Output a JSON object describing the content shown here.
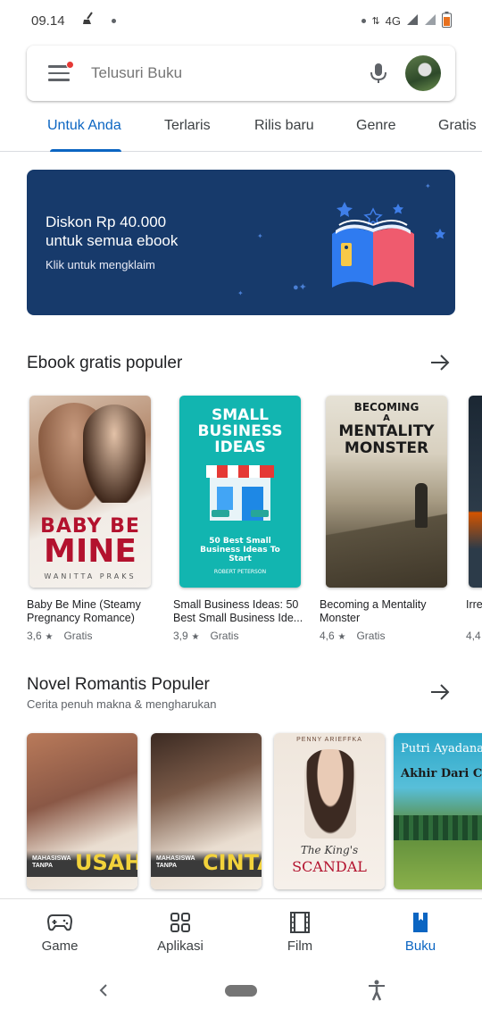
{
  "status_bar": {
    "time": "09.14",
    "network": "4G"
  },
  "search": {
    "placeholder": "Telusuri Buku"
  },
  "tabs": [
    {
      "label": "Untuk Anda",
      "active": true
    },
    {
      "label": "Terlaris"
    },
    {
      "label": "Rilis baru"
    },
    {
      "label": "Genre"
    },
    {
      "label": "Gratis"
    }
  ],
  "banner": {
    "title_line1": "Diskon Rp 40.000",
    "title_line2": "untuk semua ebook",
    "subtitle": "Klik untuk mengklaim"
  },
  "section1": {
    "title": "Ebook gratis populer",
    "books": [
      {
        "title": "Baby Be Mine (Steamy Pregnancy Romance)",
        "rating": "3,6",
        "price": "Gratis",
        "cover_line1": "BABY BE",
        "cover_line2": "MINE",
        "cover_author": "WANITTA PRAKS"
      },
      {
        "title": "Small Business Ideas: 50 Best Small Business Ide...",
        "rating": "3,9",
        "price": "Gratis",
        "cover_line1": "SMALL",
        "cover_line2": "BUSINESS",
        "cover_line3": "IDEAS",
        "cover_sub": "50 Best Small Business Ideas To Start",
        "cover_author": "ROBERT PETERSON"
      },
      {
        "title": "Becoming a Mentality Monster",
        "rating": "4,6",
        "price": "Gratis",
        "cover_line1": "BECOMING",
        "cover_line2": "A",
        "cover_line3": "MENTALITY",
        "cover_line4": "MONSTER"
      },
      {
        "title": "Irre",
        "rating": "4,4"
      }
    ]
  },
  "section2": {
    "title": "Novel Romantis Populer",
    "subtitle": "Cerita penuh makna & mengharukan",
    "books": [
      {
        "cover_small": "MAHASISWA TANPA",
        "cover_big": "USAHA"
      },
      {
        "cover_small": "MAHASISWA TANPA",
        "cover_big": "CINTA"
      },
      {
        "cover_author": "PENNY ARIEFFKA",
        "cover_line1": "The King's",
        "cover_line2": "SCANDAL"
      },
      {
        "cover_author": "Putri Ayadana",
        "cover_title": "Akhir Dari Cinta"
      }
    ]
  },
  "bottom_nav": [
    {
      "label": "Game",
      "icon": "gamepad-icon"
    },
    {
      "label": "Aplikasi",
      "icon": "apps-grid-icon"
    },
    {
      "label": "Film",
      "icon": "film-icon"
    },
    {
      "label": "Buku",
      "icon": "book-icon",
      "active": true
    }
  ],
  "colors": {
    "accent": "#0b65c2",
    "banner_bg": "#173a6b"
  }
}
